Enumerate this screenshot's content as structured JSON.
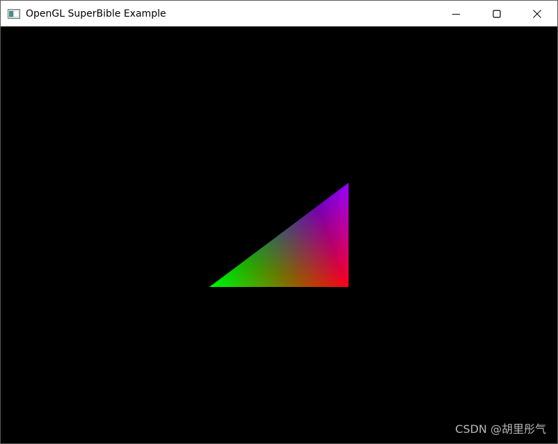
{
  "window": {
    "title": "OpenGL SuperBible Example"
  },
  "icons": {
    "app": "application-window-icon",
    "minimize": "minimize-icon",
    "maximize": "maximize-icon",
    "close": "close-icon"
  },
  "scene": {
    "background": "#000000",
    "vertex_colors": [
      "#ff0000",
      "#00ff00",
      "#0000ff"
    ]
  },
  "watermark": "CSDN @胡里彤气"
}
